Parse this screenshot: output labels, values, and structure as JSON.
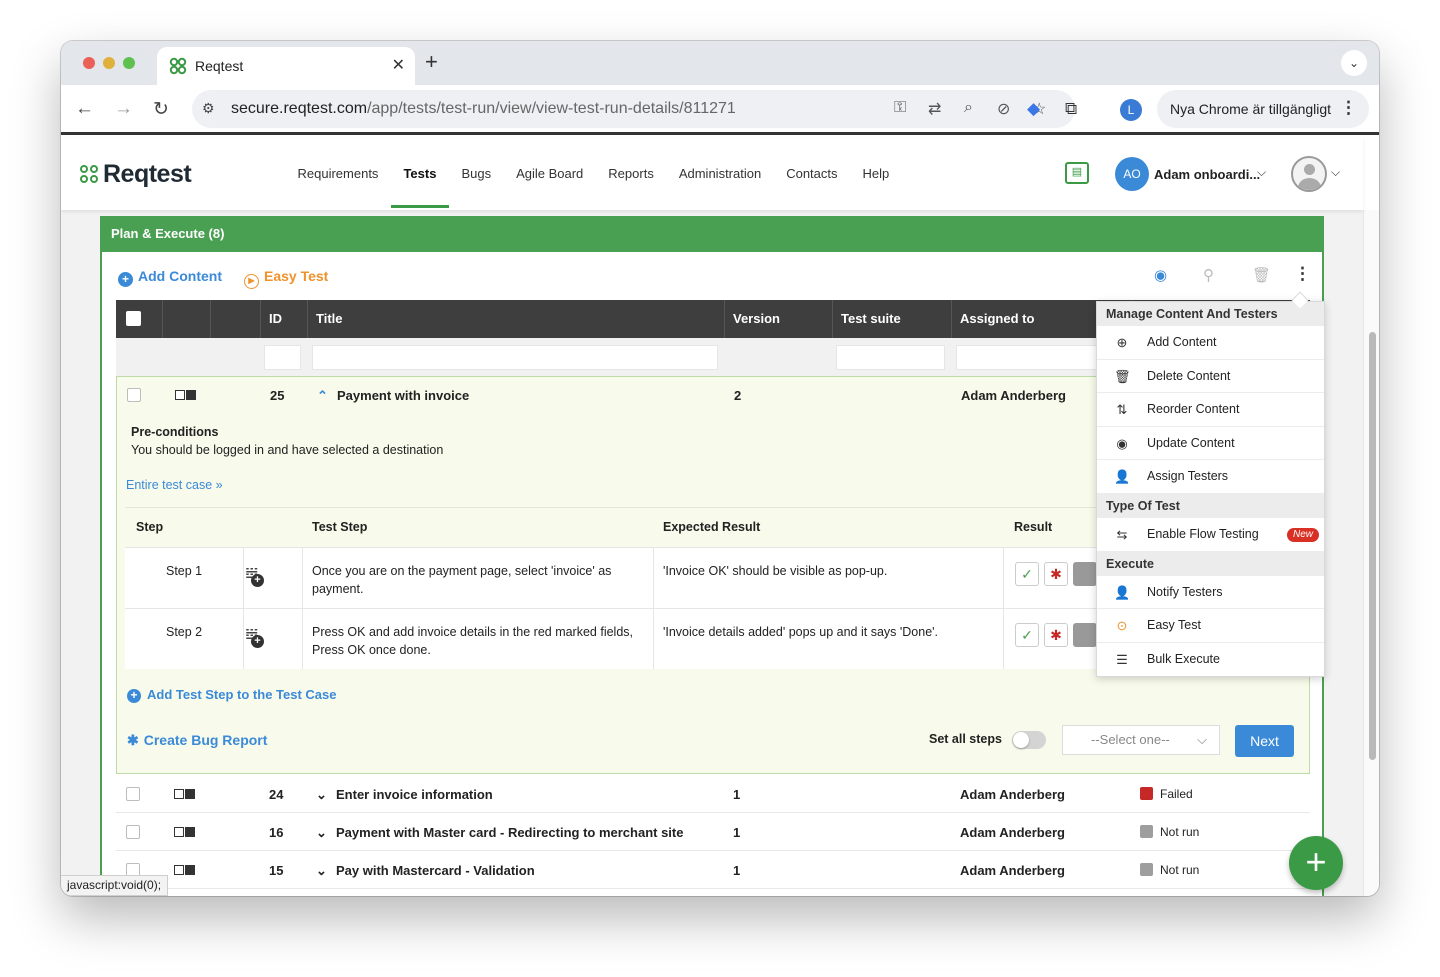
{
  "browser": {
    "tab_title": "Reqtest",
    "url_domain": "secure.reqtest.com",
    "url_path": "/app/tests/test-run/view/view-test-run-details/811271",
    "profile_initial": "L",
    "update_text": "Nya Chrome är tillgängligt",
    "status_bar_text": "javascript:void(0);"
  },
  "app": {
    "brand": "Reqtest",
    "nav": [
      "Requirements",
      "Tests",
      "Bugs",
      "Agile Board",
      "Reports",
      "Administration",
      "Contacts",
      "Help"
    ],
    "active_nav": "Tests",
    "user_initials": "AO",
    "user_name": "Adam onboardi..."
  },
  "panel": {
    "title": "Plan & Execute (8)",
    "add_content": "Add Content",
    "easy_test": "Easy Test"
  },
  "grid": {
    "columns": [
      "ID",
      "Title",
      "Version",
      "Test suite",
      "Assigned to"
    ]
  },
  "expanded_case": {
    "id": "25",
    "title": "Payment with invoice",
    "version": "2",
    "assigned_to": "Adam Anderberg",
    "precond_label": "Pre-conditions",
    "precond_text": "You should be logged in and have selected a destination",
    "entire_link": "Entire test case »",
    "step_headers": [
      "Step",
      "Test Step",
      "Expected Result",
      "Result"
    ],
    "steps": [
      {
        "step": "Step 1",
        "test_step": "Once you are on the payment page, select 'invoice' as payment.",
        "expected": "'Invoice OK' should be visible as pop-up."
      },
      {
        "step": "Step 2",
        "test_step": "Press OK and add invoice details in the red marked fields, Press OK once done.",
        "expected": "'Invoice details added' pops up and it says 'Done'."
      }
    ],
    "add_step": "Add Test Step to the Test Case",
    "create_bug": "Create Bug Report",
    "set_all": "Set all steps",
    "select_placeholder": "--Select one--",
    "next": "Next"
  },
  "rows": [
    {
      "id": "24",
      "title": "Enter invoice information",
      "version": "1",
      "assigned": "Adam Anderberg",
      "status": "Failed",
      "status_color": "#c62828"
    },
    {
      "id": "16",
      "title": "Payment with Master card - Redirecting to merchant site",
      "version": "1",
      "assigned": "Adam Anderberg",
      "status": "Not run",
      "status_color": "#9e9e9e"
    },
    {
      "id": "15",
      "title": "Pay with Mastercard - Validation",
      "version": "1",
      "assigned": "Adam Anderberg",
      "status": "Not run",
      "status_color": "#9e9e9e"
    }
  ],
  "menu": {
    "sec1": "Manage Content And Testers",
    "sec1_items": [
      "Add Content",
      "Delete Content",
      "Reorder Content",
      "Update Content",
      "Assign Testers"
    ],
    "sec2": "Type Of Test",
    "sec2_items": [
      "Enable Flow Testing"
    ],
    "new_badge": "New",
    "sec3": "Execute",
    "sec3_items": [
      "Notify Testers",
      "Easy Test",
      "Bulk Execute"
    ]
  },
  "colors": {
    "brand_green": "#4aa052",
    "accent_blue": "#3b8ad8",
    "easy_orange": "#f0922b"
  }
}
